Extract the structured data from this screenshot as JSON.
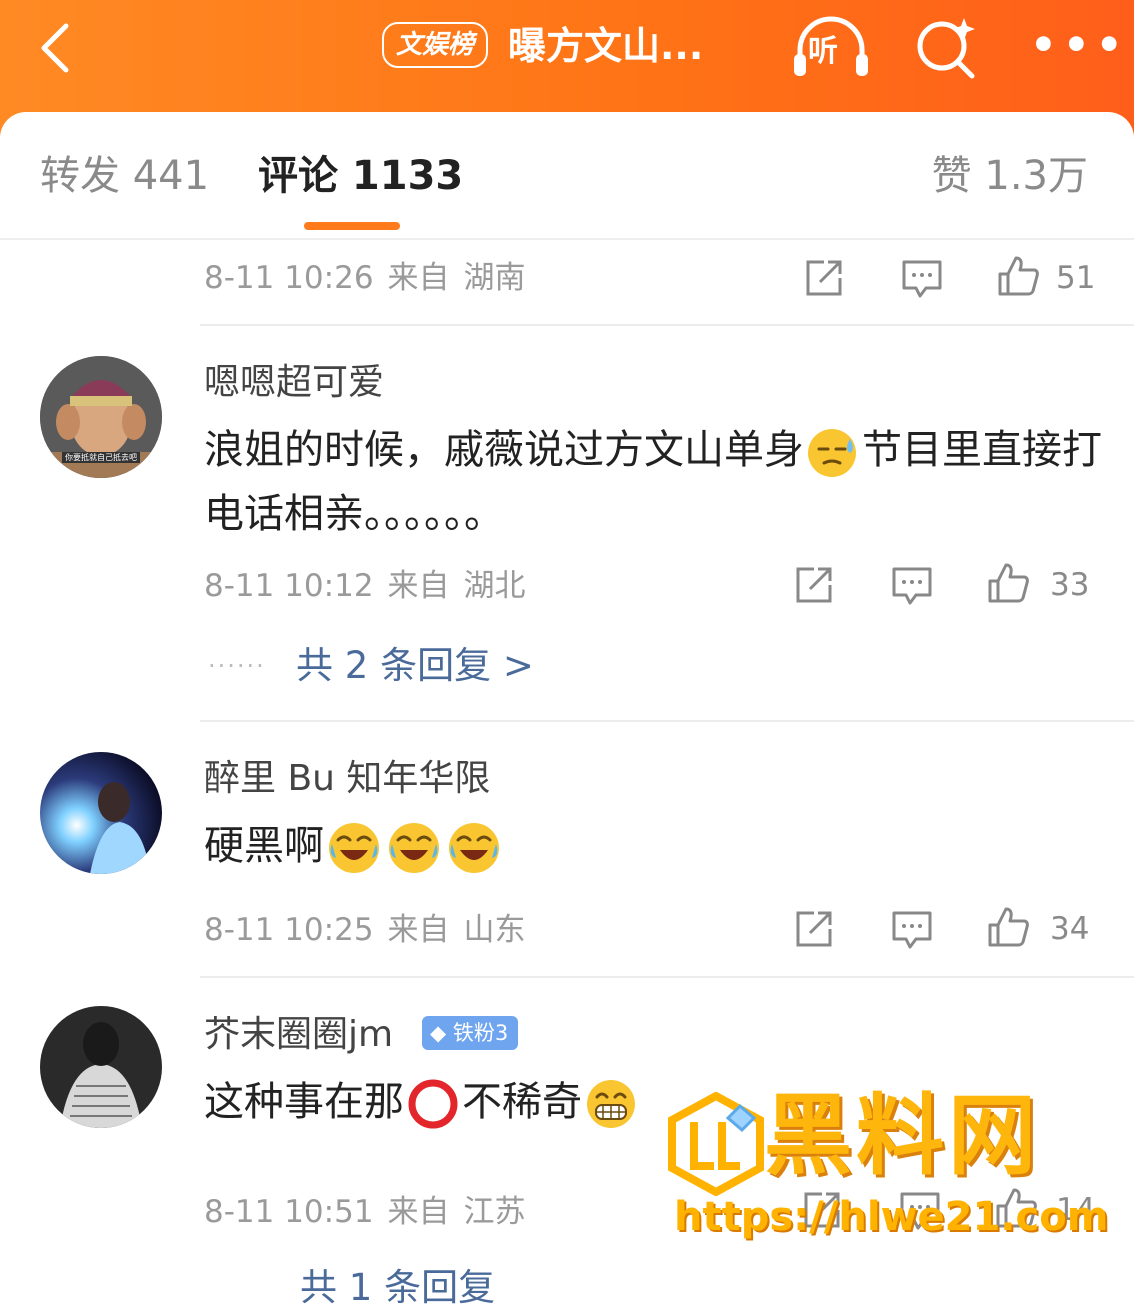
{
  "header": {
    "tag": "文娱榜",
    "title": "曝方文山...",
    "listen_label": "听"
  },
  "tabs": {
    "repost": "转发 441",
    "comment": "评论 1133",
    "like": "赞 1.3万"
  },
  "comments": [
    {
      "date": "8-11 10:26",
      "from": "来自",
      "location": "湖南",
      "likes": "51"
    },
    {
      "username": "嗯嗯超可爱",
      "avatar_caption": "你要抵就自己抵去吧",
      "text_before": "浪姐的时候，戚薇说过方文山单身",
      "text_after": "节目里直接打电话相亲。。。。。。",
      "date": "8-11 10:12",
      "from": "来自",
      "location": "湖北",
      "likes": "33",
      "replies": "共 2 条回复 >"
    },
    {
      "username": "醉里 Bu 知年华限",
      "text": "硬黑啊",
      "date": "8-11 10:25",
      "from": "来自",
      "location": "山东",
      "likes": "34"
    },
    {
      "username": "芥末圈圈jm",
      "badge": "铁粉3",
      "text_before": "这种事在那",
      "text_after": "不稀奇",
      "date": "8-11 10:51",
      "from": "来自",
      "location": "江苏",
      "likes": "14",
      "replies": "共 1 条回复"
    }
  ],
  "watermark": {
    "text": "黑料网",
    "url": "https://hlwe21.com"
  },
  "colors": {
    "header": "#ff7a1a",
    "accent": "#ff7a1a",
    "link": "#4a6b9a",
    "badge": "#6fa5ef"
  },
  "icons": [
    "back-arrow-icon",
    "listen-headphones-icon",
    "search-sparkle-icon",
    "more-icon",
    "share-icon",
    "comment-icon",
    "thumbs-up-icon"
  ]
}
